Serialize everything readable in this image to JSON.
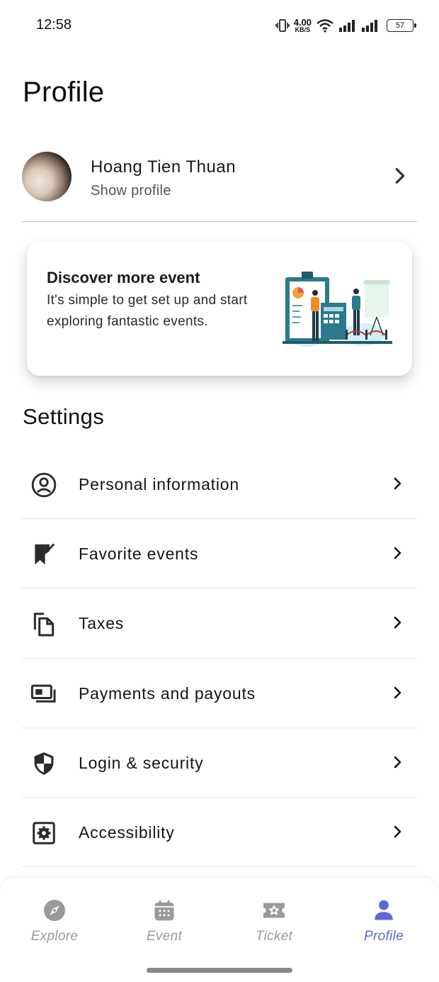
{
  "status_bar": {
    "time": "12:58",
    "net_speed_value": "4.00",
    "net_speed_unit": "KB/S",
    "battery": "57"
  },
  "page": {
    "title": "Profile"
  },
  "profile": {
    "name": "Hoang Tien Thuan",
    "subtitle": "Show profile"
  },
  "discover_card": {
    "title": "Discover more event",
    "text": "It's simple to get set up and start exploring fantastic events."
  },
  "settings": {
    "title": "Settings",
    "items": [
      {
        "label": "Personal information",
        "icon": "account-circle-icon"
      },
      {
        "label": "Favorite events",
        "icon": "bookmark-check-icon"
      },
      {
        "label": "Taxes",
        "icon": "copy-document-icon"
      },
      {
        "label": "Payments and payouts",
        "icon": "payments-icon"
      },
      {
        "label": "Login & security",
        "icon": "shield-icon"
      },
      {
        "label": "Accessibility",
        "icon": "settings-box-icon"
      }
    ]
  },
  "bottom_nav": {
    "items": [
      {
        "label": "Explore",
        "icon": "compass-icon",
        "active": false
      },
      {
        "label": "Event",
        "icon": "calendar-icon",
        "active": false
      },
      {
        "label": "Ticket",
        "icon": "ticket-icon",
        "active": false
      },
      {
        "label": "Profile",
        "icon": "person-icon",
        "active": true
      }
    ]
  },
  "colors": {
    "accent": "#5b6ad0",
    "inactive_nav": "#9a9a9a",
    "illustration_teal": "#2a7a8c"
  }
}
